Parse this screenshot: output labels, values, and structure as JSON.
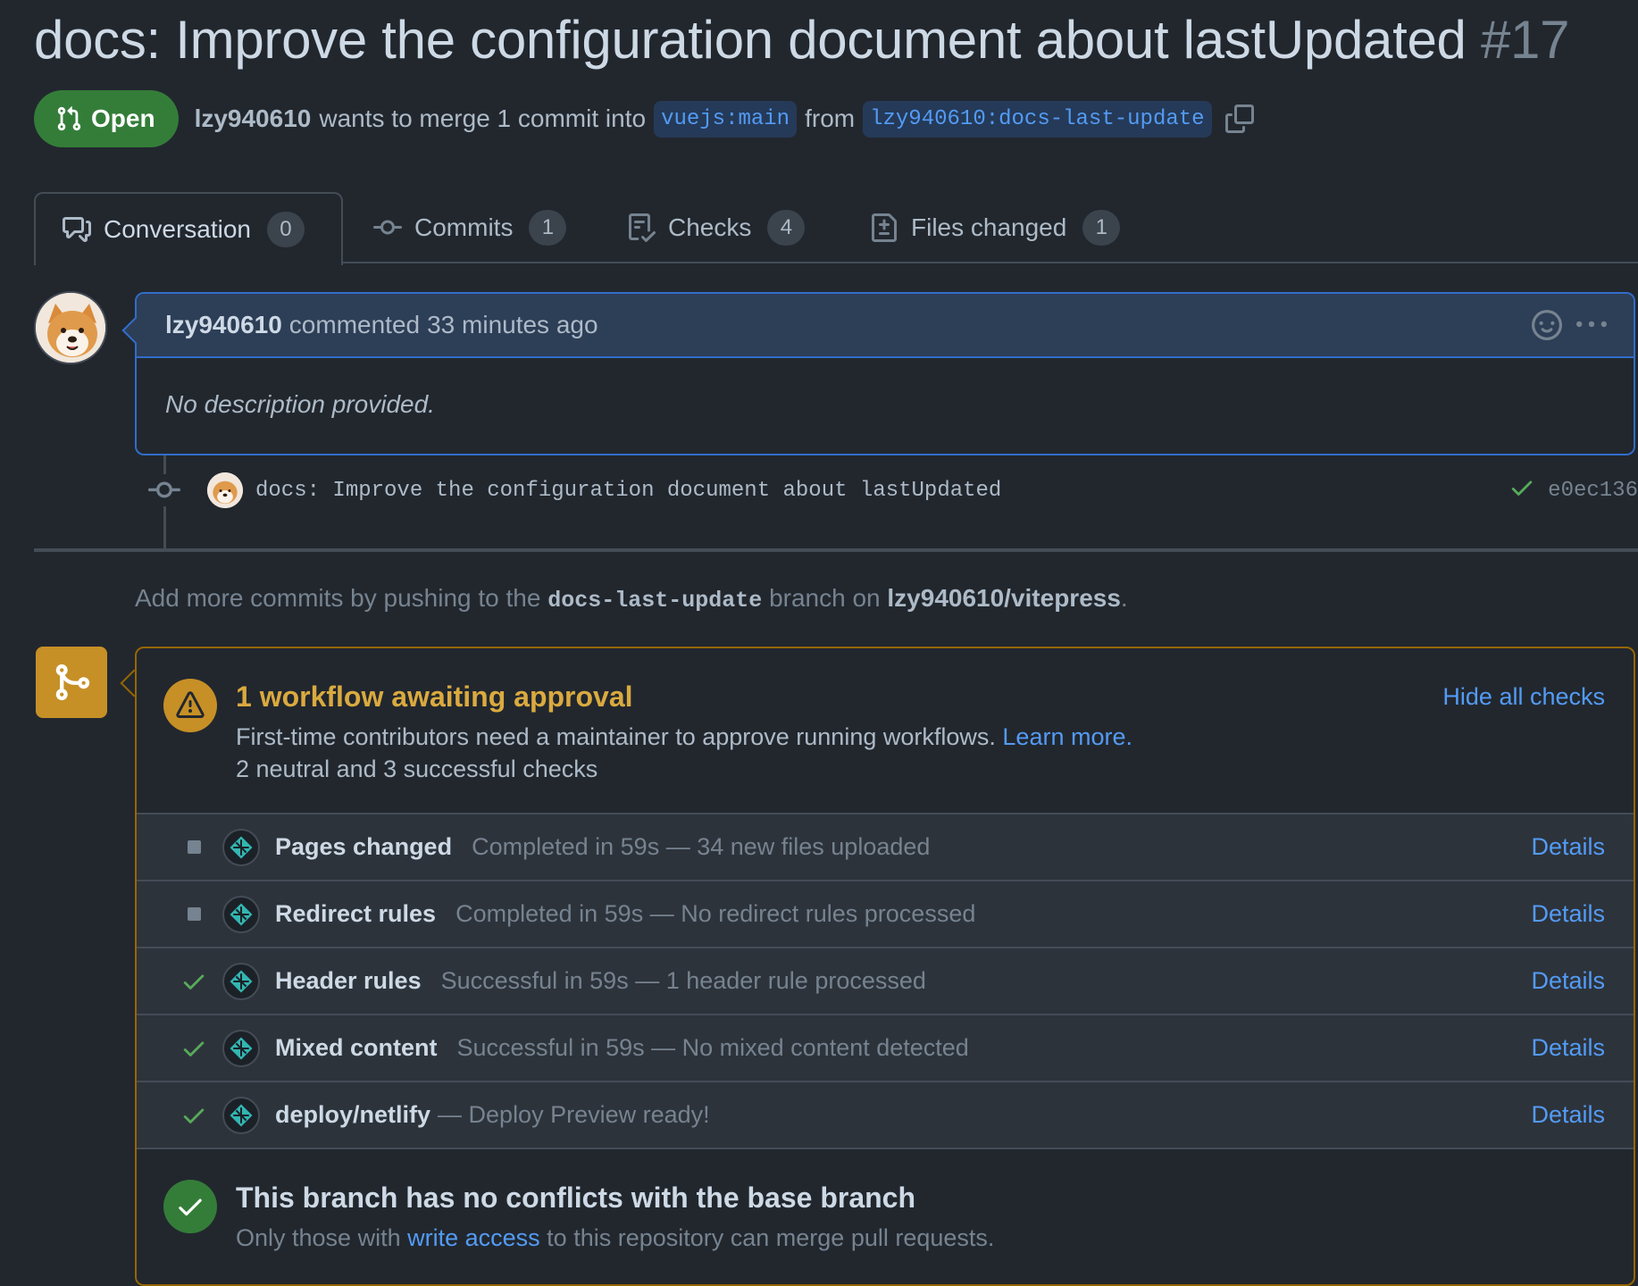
{
  "pr": {
    "title": "docs: Improve the configuration document about lastUpdated",
    "number": "#17",
    "state": "Open",
    "author": "lzy940610",
    "merge_text": "wants to merge 1 commit into",
    "base_branch": "vuejs:main",
    "from_text": "from",
    "head_branch": "lzy940610:docs-last-update"
  },
  "tabs": [
    {
      "label": "Conversation",
      "count": "0",
      "icon": "comment-discussion-icon"
    },
    {
      "label": "Commits",
      "count": "1",
      "icon": "git-commit-icon"
    },
    {
      "label": "Checks",
      "count": "4",
      "icon": "checklist-icon"
    },
    {
      "label": "Files changed",
      "count": "1",
      "icon": "file-diff-icon"
    }
  ],
  "comment": {
    "author": "lzy940610",
    "action": "commented",
    "time": "33 minutes ago",
    "body": "No description provided."
  },
  "commit": {
    "message": "docs: Improve the configuration document about lastUpdated",
    "sha": "e0ec136"
  },
  "push_hint": {
    "prefix": "Add more commits by pushing to the",
    "branch": "docs-last-update",
    "middle": "branch on",
    "repo": "lzy940610/vitepress",
    "suffix": "."
  },
  "approval": {
    "title": "1 workflow awaiting approval",
    "hide_link": "Hide all checks",
    "description": "First-time contributors need a maintainer to approve running workflows.",
    "learn_more": "Learn more.",
    "summary": "2 neutral and 3 successful checks"
  },
  "checks": [
    {
      "status": "neutral",
      "name": "Pages changed",
      "description": "Completed in 59s — 34 new files uploaded",
      "details": "Details"
    },
    {
      "status": "neutral",
      "name": "Redirect rules",
      "description": "Completed in 59s — No redirect rules processed",
      "details": "Details"
    },
    {
      "status": "success",
      "name": "Header rules",
      "description": "Successful in 59s — 1 header rule processed",
      "details": "Details"
    },
    {
      "status": "success",
      "name": "Mixed content",
      "description": "Successful in 59s — No mixed content detected",
      "details": "Details"
    },
    {
      "status": "success",
      "name": "deploy/netlify",
      "description": "— Deploy Preview ready!",
      "details": "Details"
    }
  ],
  "conflicts": {
    "title": "This branch has no conflicts with the base branch",
    "prefix": "Only those with",
    "link": "write access",
    "suffix": "to this repository can merge pull requests."
  },
  "colors": {
    "background": "#22272e",
    "open_badge": "#347d39",
    "link": "#539bf5",
    "warning": "#c69026",
    "success": "#57ab5a"
  }
}
